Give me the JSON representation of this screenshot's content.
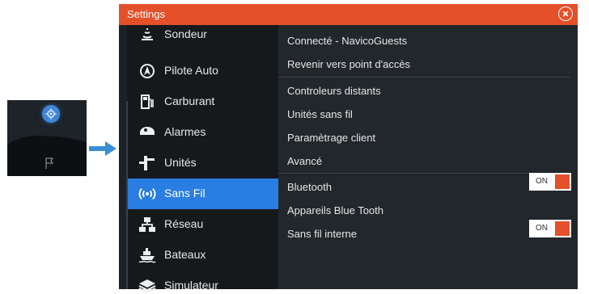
{
  "window": {
    "title": "Settings"
  },
  "menu": {
    "items": [
      {
        "label": "Sondeur",
        "icon": "sonar-icon",
        "active": false
      },
      {
        "label": "Pilote Auto",
        "icon": "autopilot-icon",
        "active": false
      },
      {
        "label": "Carburant",
        "icon": "fuel-icon",
        "active": false
      },
      {
        "label": "Alarmes",
        "icon": "alarm-icon",
        "active": false
      },
      {
        "label": "Unités",
        "icon": "units-icon",
        "active": false
      },
      {
        "label": "Sans Fil",
        "icon": "wireless-icon",
        "active": true
      },
      {
        "label": "Réseau",
        "icon": "network-icon",
        "active": false
      },
      {
        "label": "Bateaux",
        "icon": "boat-icon",
        "active": false
      },
      {
        "label": "Simulateur",
        "icon": "simulator-icon",
        "active": false
      }
    ]
  },
  "panel": {
    "rows": [
      {
        "label": "Connecté - NavicoGuests"
      },
      {
        "label": "Revenir vers point d'accès"
      },
      {
        "label": "Controleurs distants"
      },
      {
        "label": "Unités sans fil"
      },
      {
        "label": "Paramètrage client"
      },
      {
        "label": "Avancé"
      },
      {
        "label": "Bluetooth",
        "toggle": "ON"
      },
      {
        "label": "Appareils Blue Tooth"
      },
      {
        "label": "Sans fil interne",
        "toggle": "ON"
      }
    ]
  },
  "colors": {
    "accent": "#e3502a",
    "active": "#2a7de1",
    "arrow": "#3a8fd4"
  }
}
